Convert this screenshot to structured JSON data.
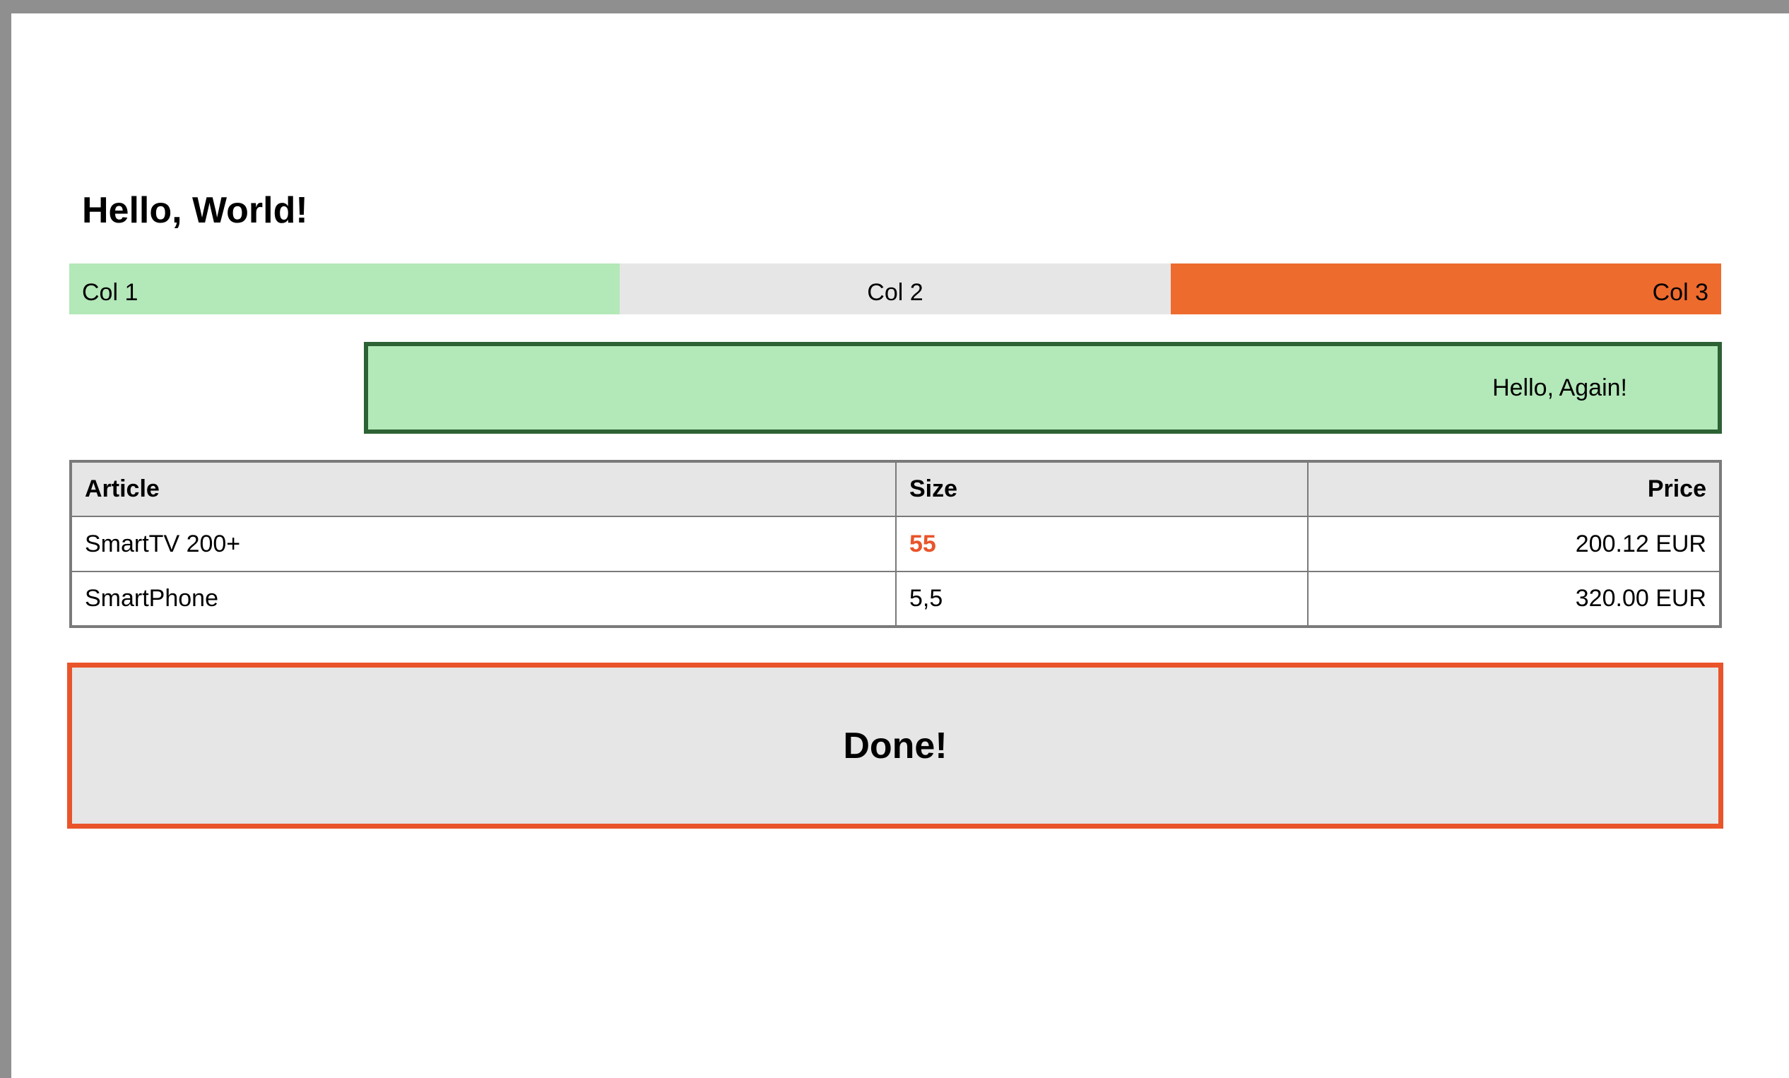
{
  "heading": "Hello, World!",
  "columns": [
    "Col 1",
    "Col 2",
    "Col 3"
  ],
  "column_colors": [
    "#b3e8b8",
    "#e6e6e6",
    "#ee6b2e"
  ],
  "banner": {
    "text": "Hello, Again!",
    "background": "#b3e8b8",
    "border": "#2d6234"
  },
  "table": {
    "headers": {
      "article": "Article",
      "size": "Size",
      "price": "Price"
    },
    "rows": [
      {
        "article": "SmartTV 200+",
        "size": "55",
        "price": "200.12 EUR"
      },
      {
        "article": "SmartPhone",
        "size": "5,5",
        "price": "320.00 EUR"
      }
    ],
    "highlight_color": "#e9542a"
  },
  "footer": {
    "text": "Done!",
    "border": "#e9542a"
  }
}
